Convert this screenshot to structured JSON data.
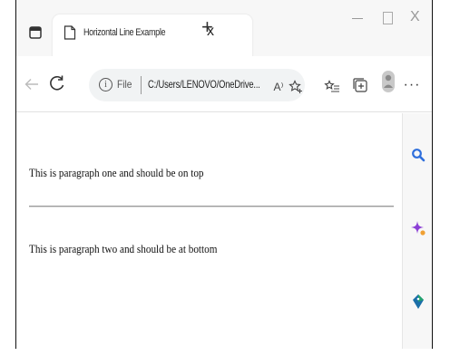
{
  "tab": {
    "title": "Horizontal Line Example",
    "close_glyph": "x"
  },
  "tabstrip": {
    "new_tab_glyph": "+",
    "window_close_glyph": "X"
  },
  "toolbar": {
    "file_label": "File",
    "url": "C:/Users/LENOVO/OneDrive...",
    "read_aloud_label": "A⁾",
    "more_label": "···"
  },
  "page": {
    "paragraph_one": "This is paragraph one and should be on top",
    "paragraph_two": "This is paragraph two and should be at bottom"
  },
  "icons": {
    "tab_actions": "tab-actions-icon",
    "favicon": "page-icon",
    "back": "back-arrow-icon",
    "refresh": "refresh-icon",
    "info": "info-icon",
    "favorite": "star-plus-icon",
    "favorites": "favorites-list-icon",
    "collections": "collections-icon",
    "profile": "profile-icon",
    "sidebar_search": "search-icon",
    "sidebar_copilot": "copilot-sparkle-icon",
    "sidebar_tag": "tag-icon"
  },
  "colors": {
    "search_blue": "#2f6fdc",
    "copilot_purple": "#8b3fd6",
    "copilot_orange": "#f0a033",
    "tag_blue": "#1b6fa8",
    "tag_green": "#22a36c"
  }
}
